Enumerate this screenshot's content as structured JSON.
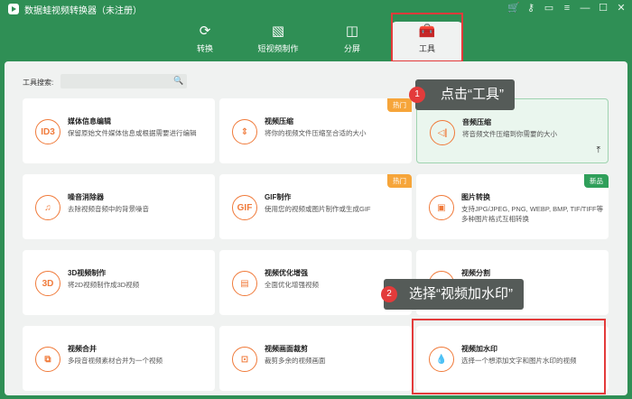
{
  "app": {
    "title": "数据蛙视频转换器（未注册）",
    "window_icons": [
      "cart-icon",
      "key-icon",
      "chat-icon",
      "menu-icon",
      "minimize-icon",
      "maximize-icon",
      "close-icon"
    ]
  },
  "tabs": [
    {
      "label": "转换",
      "icon": "convert-icon"
    },
    {
      "label": "短视频制作",
      "icon": "image-icon"
    },
    {
      "label": "分屏",
      "icon": "split-icon"
    },
    {
      "label": "工具",
      "icon": "toolbox-icon",
      "active": true
    }
  ],
  "search": {
    "label": "工具搜索:",
    "value": ""
  },
  "tools": [
    {
      "name": "媒体信息编辑",
      "desc": "保留原始文件媒体信息或根据需要进行编辑",
      "icon_text": "ID3"
    },
    {
      "name": "视频压缩",
      "desc": "将你的视频文件压缩至合适的大小",
      "icon_text": "⇕",
      "badge": "热门"
    },
    {
      "name": "音频压缩",
      "desc": "将音频文件压缩到你需要的大小",
      "icon_text": "◁|"
    },
    {
      "name": "噪音消除器",
      "desc": "去除视频音频中的背景噪音",
      "icon_text": "♫"
    },
    {
      "name": "GIF制作",
      "desc": "使用您的视频或图片制作或生成GIF",
      "icon_text": "GIF",
      "badge": "热门"
    },
    {
      "name": "图片转换",
      "desc": "支持JPG/JPEG, PNG, WEBP, BMP, TIF/TIFF等多种图片格式互相转换",
      "icon_text": "▣",
      "badge": "新品"
    },
    {
      "name": "3D视频制作",
      "desc": "将2D视频制作成3D视频",
      "icon_text": "3D"
    },
    {
      "name": "视频优化增强",
      "desc": "全面优化增强视频",
      "icon_text": "▤"
    },
    {
      "name": "视频分割",
      "desc": "",
      "icon_text": "✂"
    },
    {
      "name": "视频合并",
      "desc": "多段音视频素材合并为一个视频",
      "icon_text": "⧉"
    },
    {
      "name": "视频画面裁剪",
      "desc": "裁剪多余的视频画面",
      "icon_text": "⊡"
    },
    {
      "name": "视频加水印",
      "desc": "选择一个想添加文字和图片水印的视频",
      "icon_text": "💧"
    }
  ],
  "callouts": [
    {
      "num": "1",
      "text": "点击“工具”"
    },
    {
      "num": "2",
      "text": "选择“视频加水印”"
    }
  ]
}
